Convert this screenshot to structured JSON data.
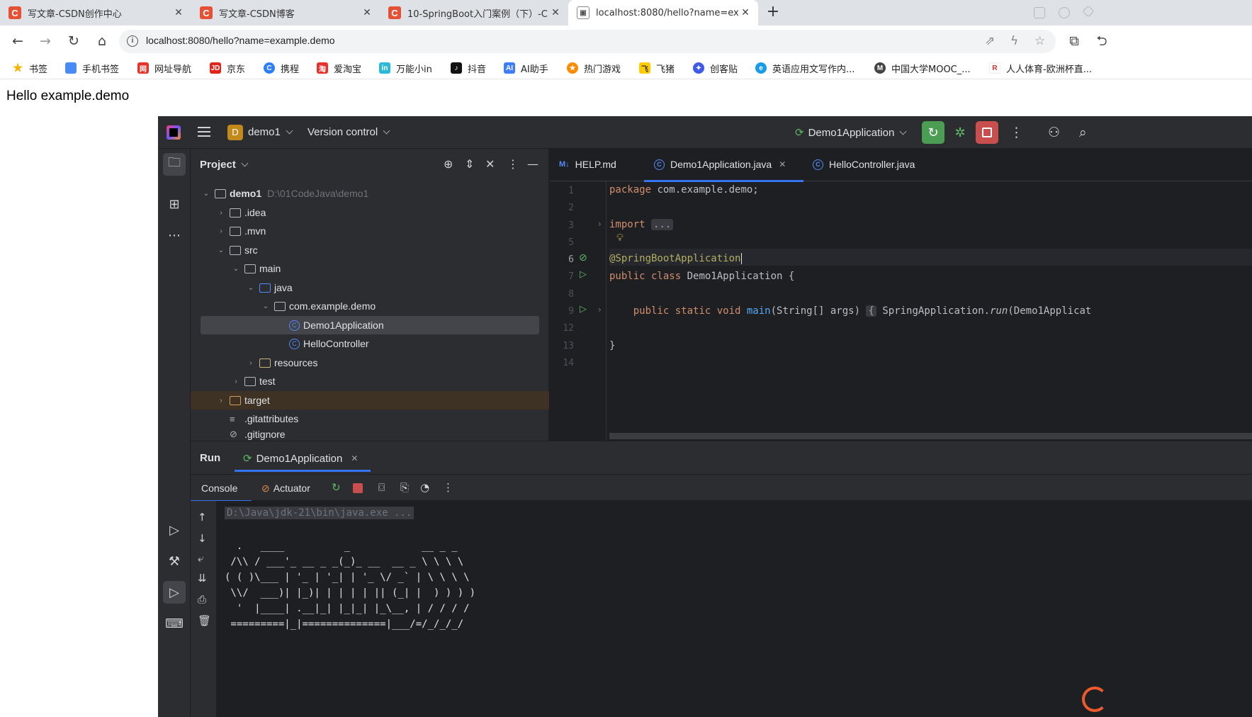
{
  "browser": {
    "tabs": [
      {
        "favicon": "C",
        "title": "写文章-CSDN创作中心"
      },
      {
        "favicon": "C",
        "title": "写文章-CSDN博客"
      },
      {
        "favicon": "C",
        "title": "10-SpringBoot入门案例（下）-C"
      },
      {
        "favicon": "img",
        "title": "localhost:8080/hello?name=ex"
      }
    ],
    "url": "localhost:8080/hello?name=example.demo",
    "bookmarks": [
      {
        "label": "书签",
        "color": "#f5b400"
      },
      {
        "label": "手机书签",
        "color": "#4a8af4"
      },
      {
        "label": "网址导航",
        "color": "#e8312a"
      },
      {
        "label": "京东",
        "color": "#e1251b"
      },
      {
        "label": "携程",
        "color": "#2d7ff9"
      },
      {
        "label": "爱淘宝",
        "color": "#e8312a"
      },
      {
        "label": "万能小in",
        "color": "#2bbad5"
      },
      {
        "label": "抖音",
        "color": "#111111"
      },
      {
        "label": "AI助手",
        "color": "#3d7eff"
      },
      {
        "label": "热门游戏",
        "color": "#ff8a00"
      },
      {
        "label": "飞猪",
        "color": "#ffcc00"
      },
      {
        "label": "创客贴",
        "color": "#3f59e8"
      },
      {
        "label": "英语应用文写作内...",
        "color": "#1a9be8"
      },
      {
        "label": "中国大学MOOC_...",
        "color": "#444444"
      },
      {
        "label": "人人体育-欧洲杯直...",
        "color": "#d9342b"
      }
    ]
  },
  "page": {
    "body_text": "Hello example.demo"
  },
  "ide": {
    "project_badge": "D",
    "project_name": "demo1",
    "vcs": "Version control",
    "run_config": "Demo1Application",
    "project_panel": {
      "title": "Project",
      "tree": [
        {
          "label": "demo1",
          "hint": "D:\\01CodeJava\\demo1",
          "kind": "module",
          "expanded": true
        },
        {
          "label": ".idea",
          "kind": "folder",
          "expanded": false
        },
        {
          "label": ".mvn",
          "kind": "folder",
          "expanded": false
        },
        {
          "label": "src",
          "kind": "folder",
          "expanded": true
        },
        {
          "label": "main",
          "kind": "folder",
          "expanded": true
        },
        {
          "label": "java",
          "kind": "source-folder",
          "expanded": true
        },
        {
          "label": "com.example.demo",
          "kind": "package",
          "expanded": true
        },
        {
          "label": "Demo1Application",
          "kind": "class",
          "selected": true
        },
        {
          "label": "HelloController",
          "kind": "class"
        },
        {
          "label": "resources",
          "kind": "resource-folder",
          "expanded": false
        },
        {
          "label": "test",
          "kind": "folder",
          "expanded": false
        },
        {
          "label": "target",
          "kind": "excluded-folder",
          "expanded": false
        },
        {
          "label": ".gitattributes",
          "kind": "file"
        },
        {
          "label": ".gitignore",
          "kind": "file"
        }
      ]
    },
    "editor": {
      "tabs": [
        {
          "label": "HELP.md",
          "icon": "M↓"
        },
        {
          "label": "Demo1Application.java",
          "icon": "C",
          "active": true
        },
        {
          "label": "HelloController.java",
          "icon": "C"
        }
      ],
      "line_numbers": [
        "1",
        "2",
        "3",
        "5",
        "6",
        "7",
        "8",
        "9",
        "12",
        "13",
        "14"
      ],
      "current_line": "6",
      "code": {
        "l1_kw": "package",
        "l1_rest": " com.example.demo;",
        "l3_kw": "import",
        "l3_fold": "...",
        "l6_ann": "@SpringBootApplication",
        "l7_kw": "public class",
        "l7_rest": " Demo1Application {",
        "l9_kw": "public static void",
        "l9_fn": "main",
        "l9_sig": "(String[] args)",
        "l9_fold": "{",
        "l9_body": " SpringApplication.",
        "l9_run": "run",
        "l9_tail": "(Demo1Applicat",
        "l13": "}"
      }
    },
    "run_panel": {
      "title": "Run",
      "tab": "Demo1Application",
      "subtabs": {
        "console": "Console",
        "actuator": "Actuator"
      },
      "command": "D:\\Java\\jdk-21\\bin\\java.exe ...",
      "banner": [
        "  .   ____          _            __ _ _",
        " /\\\\ / ___'_ __ _ _(_)_ __  __ _ \\ \\ \\ \\",
        "( ( )\\___ | '_ | '_| | '_ \\/ _` | \\ \\ \\ \\",
        " \\\\/  ___)| |_)| | | | | || (_| |  ) ) ) )",
        "  '  |____| .__|_| |_|_| |_\\__, | / / / /",
        " =========|_|==============|___/=/_/_/_/"
      ]
    }
  }
}
